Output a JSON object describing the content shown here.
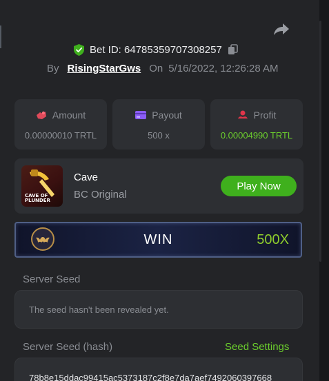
{
  "bet": {
    "id_label": "Bet ID: 64785359707308257",
    "by_label": "By",
    "username": "RisingStarGws",
    "on_label": "On",
    "datetime": "5/16/2022, 12:26:28 AM"
  },
  "stats": [
    {
      "label": "Amount",
      "value": "0.00000010 TRTL",
      "icon": "amount-icon"
    },
    {
      "label": "Payout",
      "value": "500 x",
      "icon": "payout-card-icon"
    },
    {
      "label": "Profit",
      "value": "0.00004990 TRTL",
      "icon": "profit-icon"
    }
  ],
  "game": {
    "name": "Cave",
    "subtitle": "BC Original",
    "play_label": "Play Now",
    "thumb_text_line1": "CAVE OF",
    "thumb_text_line2": "PLUNDER"
  },
  "result": {
    "label": "WIN",
    "multiplier": "500X"
  },
  "server_seed": {
    "label": "Server Seed",
    "value": "The seed hasn't been revealed yet."
  },
  "server_seed_hash": {
    "label": "Server Seed (hash)",
    "settings_label": "Seed Settings",
    "value": "78b8e15ddac99415ac5373187c2f8e7da7aef7492060397668"
  },
  "colors": {
    "panel": "#232427",
    "card": "#2d2f33",
    "accent_green": "#3fb01d",
    "profit_green": "#6ccf2d",
    "win_multiplier": "#8fcd2c"
  }
}
